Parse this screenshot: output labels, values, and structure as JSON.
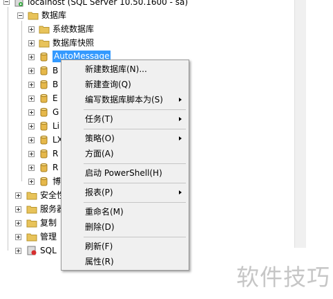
{
  "server": {
    "label": "localhost (SQL Server 10.50.1600 - sa)"
  },
  "databases_folder": {
    "label": "数据库"
  },
  "db_children": [
    {
      "label": "系统数据库",
      "type": "folder"
    },
    {
      "label": "数据库快照",
      "type": "folder"
    },
    {
      "label": "AutoMessage",
      "type": "database",
      "selected": true
    },
    {
      "label": "B",
      "type": "database"
    },
    {
      "label": "B",
      "type": "database"
    },
    {
      "label": "E",
      "type": "database"
    },
    {
      "label": "G",
      "type": "database"
    },
    {
      "label": "Li",
      "type": "database"
    },
    {
      "label": "LX",
      "type": "database"
    },
    {
      "label": "R",
      "type": "database"
    },
    {
      "label": "R",
      "type": "database"
    },
    {
      "label": "博",
      "type": "database"
    }
  ],
  "server_children": [
    {
      "label": "安全性",
      "icon": "folder-icon"
    },
    {
      "label": "服务器",
      "icon": "folder-icon"
    },
    {
      "label": "复制",
      "icon": "folder-icon"
    },
    {
      "label": "管理",
      "icon": "folder-icon"
    },
    {
      "label": "SQL",
      "icon": "sql-agent-icon"
    }
  ],
  "context_menu": {
    "items": [
      {
        "label": "新建数据库(N)...",
        "submenu": false
      },
      {
        "label": "新建查询(Q)",
        "submenu": false
      },
      {
        "label": "编写数据库脚本为(S)",
        "submenu": true
      },
      {
        "label": "任务(T)",
        "submenu": true
      },
      {
        "label": "策略(O)",
        "submenu": true
      },
      {
        "label": "方面(A)",
        "submenu": false
      },
      {
        "label": "启动 PowerShell(H)",
        "submenu": false
      },
      {
        "label": "报表(P)",
        "submenu": true
      },
      {
        "label": "重命名(M)",
        "submenu": false
      },
      {
        "label": "删除(D)",
        "submenu": false
      },
      {
        "label": "刷新(F)",
        "submenu": false
      },
      {
        "label": "属性(R)",
        "submenu": false
      }
    ]
  },
  "watermark": "软件技巧",
  "colors": {
    "selection": "#3399ff",
    "folder": "#e8c35a",
    "database": "#e6b84a"
  }
}
